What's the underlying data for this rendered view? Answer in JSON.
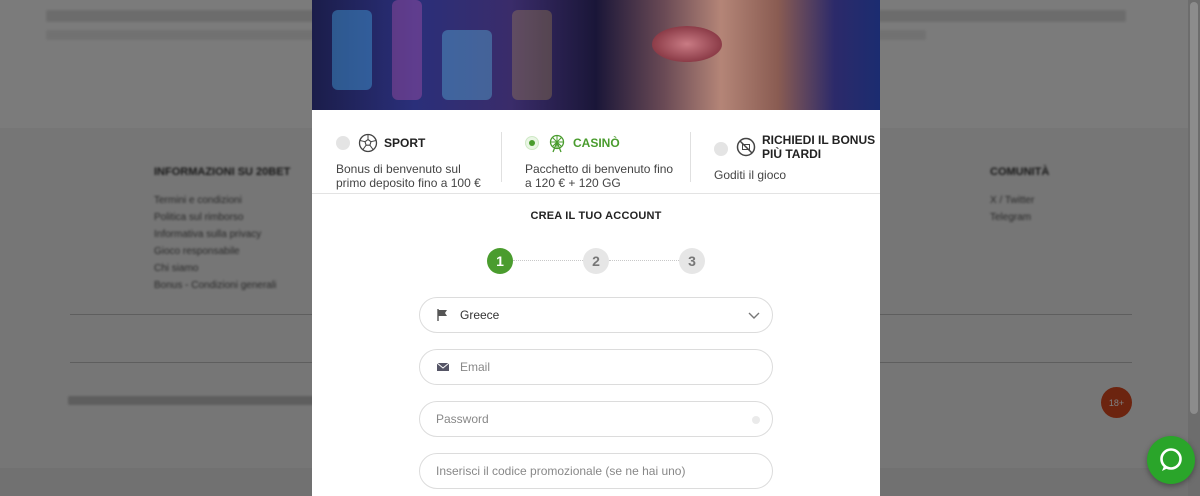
{
  "background": {
    "footer_columns": [
      {
        "heading": "INFORMAZIONI SU 20BET",
        "items": [
          "Termini e condizioni",
          "Politica sul rimborso",
          "Informativa sulla privacy",
          "Gioco responsabile",
          "Chi siamo",
          "Bonus - Condizioni generali"
        ]
      },
      {
        "heading": "COMUNITÀ",
        "items": [
          "X / Twitter",
          "Telegram"
        ]
      }
    ],
    "age_badge": "18+"
  },
  "bonuses": [
    {
      "title": "SPORT",
      "description_line1": "Bonus di benvenuto sul",
      "description_line2": "primo deposito fino a 100 €",
      "icon": "soccer-ball-icon",
      "selected": false
    },
    {
      "title": "CASINÒ",
      "description_line1": "Pacchetto di benvenuto fino",
      "description_line2": "a 120 € + 120 GG",
      "icon": "ferris-wheel-icon",
      "selected": true
    },
    {
      "title_line1": "RICHIEDI IL BONUS",
      "title_line2": "PIÙ TARDI",
      "description_line1": "Goditi il gioco",
      "icon": "no-bonus-icon",
      "selected": false
    }
  ],
  "form": {
    "title": "CREA IL TUO ACCOUNT",
    "steps": [
      "1",
      "2",
      "3"
    ],
    "active_step": 1,
    "country": {
      "value": "Greece",
      "icon": "flag-icon"
    },
    "email": {
      "placeholder": "Email",
      "icon": "envelope-icon"
    },
    "password": {
      "placeholder": "Password"
    },
    "promo": {
      "placeholder": "Inserisci il codice promozionale (se ne hai uno)"
    }
  },
  "colors": {
    "accent": "#4a9c2e",
    "chat_button": "#2aa52a"
  }
}
